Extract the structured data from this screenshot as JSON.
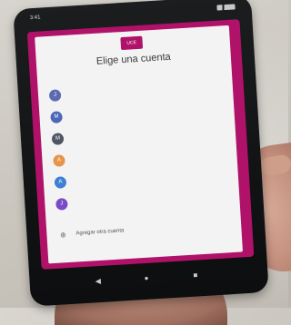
{
  "screen": {
    "status_time": "3:41",
    "logo_text": "UCE",
    "title": "Elige una cuenta",
    "subtitle": "",
    "accounts": [
      {
        "initial": "J",
        "color": "#5b6bb0",
        "name": "",
        "email": ""
      },
      {
        "initial": "M",
        "color": "#4c67b8",
        "name": "",
        "email": ""
      },
      {
        "initial": "M",
        "color": "#4f5563",
        "name": "",
        "email": ""
      },
      {
        "initial": "A",
        "color": "#e7934a",
        "name": "",
        "email": ""
      },
      {
        "initial": "A",
        "color": "#3f7fd3",
        "name": "",
        "email": ""
      },
      {
        "initial": "J",
        "color": "#7a4bc6",
        "name": "",
        "email": ""
      }
    ],
    "add_account_label": "Agregar otra cuenta",
    "footer_text": ""
  },
  "nav": {
    "back": "◀",
    "home": "●",
    "recents": "■"
  }
}
